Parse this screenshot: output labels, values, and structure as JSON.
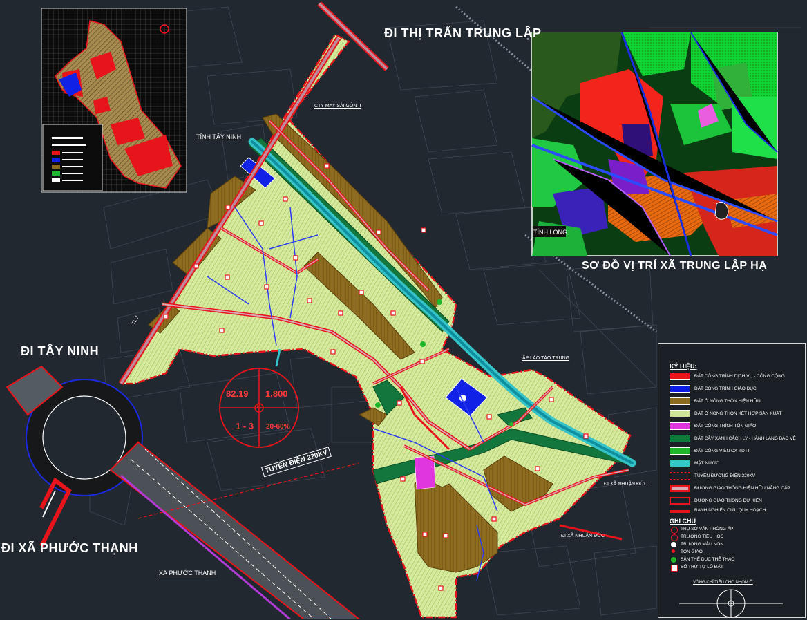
{
  "map_labels": {
    "to_trung_lap_town": "ĐI THỊ TRẤN TRUNG LẬP",
    "to_tay_ninh": "ĐI TÂY NINH",
    "to_phuoc_thanh": "ĐI XÃ PHƯỚC THẠNH",
    "location_map_title": "SƠ ĐỒ VỊ TRÍ XÃ TRUNG LẬP HẠ",
    "power_line": "TUYẾN ĐIỆN 220KV",
    "phuoc_thanh_commune": "XÃ PHƯỚC THẠNH",
    "province_tay_ninh": "TỈNH TÂY NINH",
    "province_long": "TỈNH LONG",
    "saigon_company": "CTY MAY SÀI GÒN II",
    "lao_tao_trung": "ẤP LÀO TÁO TRUNG",
    "to_nhuan_duc_1": "ĐI XÃ NHUẬN ĐỨC",
    "to_nhuan_duc_2": "ĐI XÃ NHUẬN ĐỨC",
    "tl_road": "TL 7"
  },
  "zone_badge": {
    "area": "82.19",
    "population": "1.800",
    "floors": "1 - 3",
    "density": "20-60%",
    "id": "I"
  },
  "legend": {
    "title": "KÝ HIỆU:",
    "items": [
      {
        "label": "ĐẤT CÔNG TRÌNH DỊCH VỤ - CÔNG CỘNG",
        "color": "#e8141b"
      },
      {
        "label": "ĐẤT CÔNG TRÌNH GIÁO DỤC",
        "color": "#0b1de0"
      },
      {
        "label": "ĐẤT Ở NÔNG THÔN HIỆN HỮU",
        "color": "#8a6a1c"
      },
      {
        "label": "ĐẤT Ở NÔNG THÔN KẾT HỢP SẢN XUẤT",
        "color": "#cfe59a"
      },
      {
        "label": "ĐẤT CÔNG TRÌNH TÔN GIÁO",
        "color": "#e036e0"
      },
      {
        "label": "ĐẤT CÂY XANH CÁCH LY - HÀNH LANG BẢO VỆ",
        "color": "#0e7a3a"
      },
      {
        "label": "ĐẤT CÔNG VIÊN CX-TDTT",
        "color": "#1fb62a"
      },
      {
        "label": "MẶT NƯỚC",
        "color": "#33c7c7"
      },
      {
        "label": "TUYẾN ĐƯỜNG ĐIỆN 220KV",
        "color": "#e8141b"
      },
      {
        "label": "ĐƯỜNG GIAO THÔNG HIỆN HỮU NÂNG CẤP",
        "color": "#e8141b"
      },
      {
        "label": "ĐƯỜNG GIAO THÔNG DỰ KIẾN",
        "color": "#e8141b"
      },
      {
        "label": "RANH NGHIÊN CỨU QUY HOẠCH",
        "color": "#e8141b"
      }
    ],
    "notes_title": "GHI CHÚ",
    "notes": [
      {
        "label": "TRỤ SỞ VĂN PHÒNG ẤP",
        "color": "#e8141b"
      },
      {
        "label": "TRƯỜNG TIỂU HỌC",
        "color": "#e8141b"
      },
      {
        "label": "TRƯỜNG MẪU NON",
        "color": "#ffffff"
      },
      {
        "label": "TÔN GIÁO",
        "color": "#e8141b"
      },
      {
        "label": "SÂN THỂ DỤC THỂ THAO",
        "color": "#1fb62a"
      },
      {
        "label": "SỐ THỨ TỰ LÔ ĐẤT",
        "color": "#ffffff"
      }
    ],
    "indicator_caption": "VÒNG CHỈ TIÊU CHO NHÓM Ở"
  }
}
